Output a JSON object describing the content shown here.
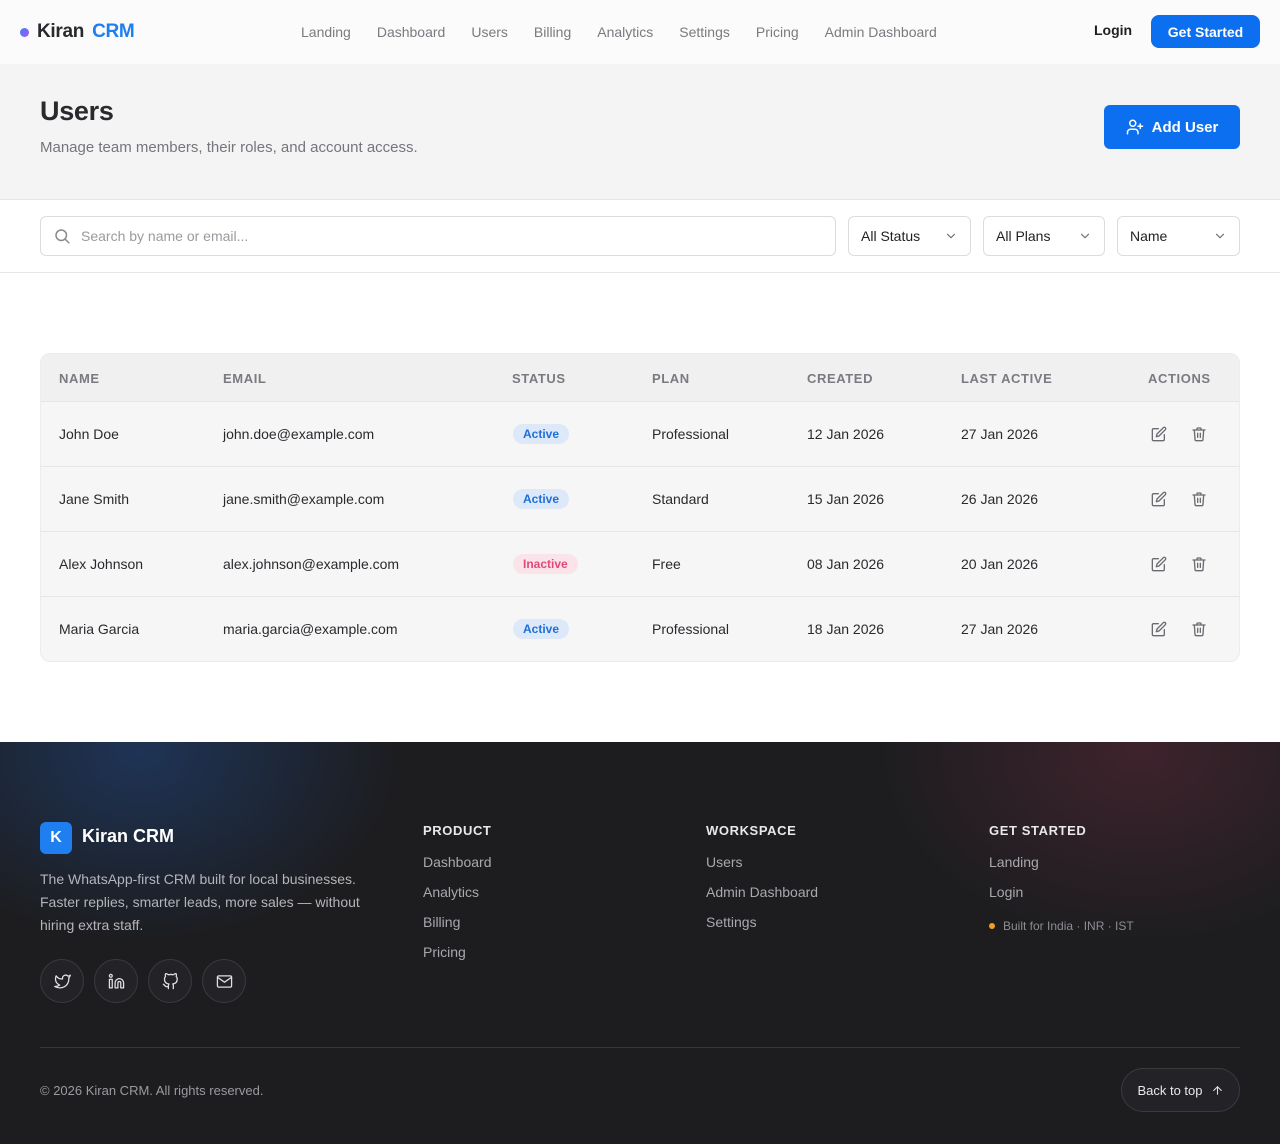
{
  "nav": {
    "brand_name": "Kiran",
    "brand_accent": "CRM",
    "links": [
      "Landing",
      "Dashboard",
      "Users",
      "Billing",
      "Analytics",
      "Settings",
      "Pricing",
      "Admin Dashboard"
    ],
    "login_label": "Login",
    "cta_label": "Get Started"
  },
  "header": {
    "title": "Users",
    "subtitle": "Manage team members, their roles, and account access.",
    "add_button_label": "Add User"
  },
  "filters": {
    "search_placeholder": "Search by name or email...",
    "search_value": "",
    "status_value": "All Status",
    "plan_value": "All Plans",
    "sort_value": "Name"
  },
  "table": {
    "columns": [
      "NAME",
      "EMAIL",
      "STATUS",
      "PLAN",
      "CREATED",
      "LAST ACTIVE",
      "ACTIONS"
    ],
    "rows": [
      {
        "name": "John Doe",
        "email": "john.doe@example.com",
        "status": "Active",
        "plan": "Professional",
        "created": "12 Jan 2026",
        "last_active": "27 Jan 2026"
      },
      {
        "name": "Jane Smith",
        "email": "jane.smith@example.com",
        "status": "Active",
        "plan": "Standard",
        "created": "15 Jan 2026",
        "last_active": "26 Jan 2026"
      },
      {
        "name": "Alex Johnson",
        "email": "alex.johnson@example.com",
        "status": "Inactive",
        "plan": "Free",
        "created": "08 Jan 2026",
        "last_active": "20 Jan 2026"
      },
      {
        "name": "Maria Garcia",
        "email": "maria.garcia@example.com",
        "status": "Active",
        "plan": "Professional",
        "created": "18 Jan 2026",
        "last_active": "27 Jan 2026"
      }
    ]
  },
  "footer": {
    "logo_letter": "K",
    "brand": "Kiran CRM",
    "description": "The WhatsApp-first CRM built for local businesses. Faster replies, smarter leads, more sales — without hiring extra staff.",
    "social_icons": [
      "twitter-icon",
      "linkedin-icon",
      "github-icon",
      "mail-icon"
    ],
    "columns": [
      {
        "heading": "PRODUCT",
        "links": [
          "Dashboard",
          "Analytics",
          "Billing",
          "Pricing"
        ]
      },
      {
        "heading": "WORKSPACE",
        "links": [
          "Users",
          "Admin Dashboard",
          "Settings"
        ]
      },
      {
        "heading": "GET STARTED",
        "links": [
          "Landing",
          "Login"
        ]
      }
    ],
    "note": "Built for India · INR · IST",
    "copyright": "© 2026 Kiran CRM. All rights reserved.",
    "back_to_top": "Back to top"
  },
  "colors": {
    "primary": "#0b6ff0",
    "accent_text": "#1f7ef0",
    "active_badge_bg": "#dde9f8",
    "active_badge_text": "#1f6fd8",
    "inactive_badge_bg": "#fbe3ea",
    "inactive_badge_text": "#e04a7a",
    "footer_bg": "#1d1d20"
  }
}
